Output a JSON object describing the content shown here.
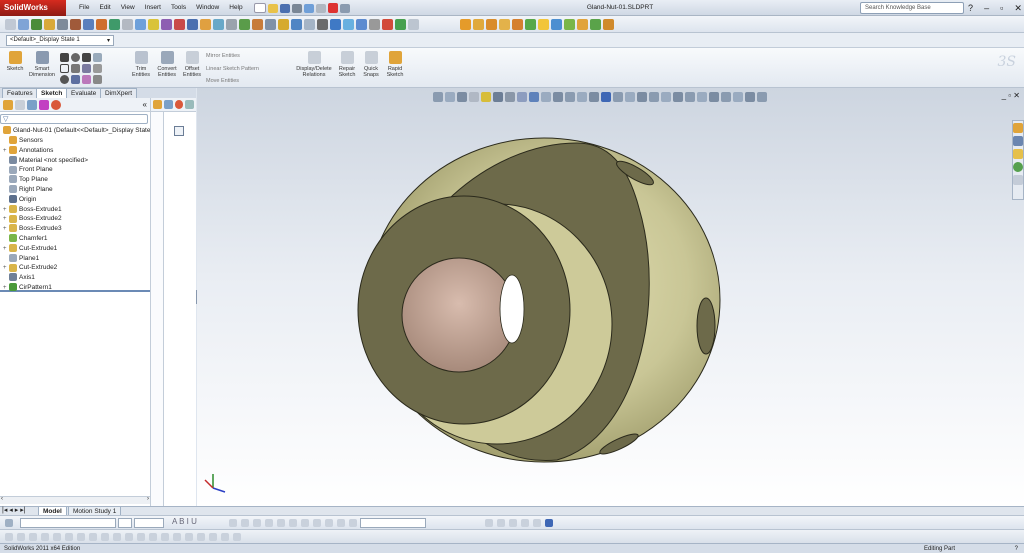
{
  "app": {
    "name": "SolidWorks",
    "menus": [
      "File",
      "Edit",
      "View",
      "Insert",
      "Tools",
      "Window",
      "Help"
    ],
    "document_title": "Gland-Nut-01.SLDPRT",
    "search_placeholder": "Search Knowledge Base",
    "window_controls": [
      "?",
      "–",
      "▫",
      "✕"
    ],
    "pin_icon": "›"
  },
  "config": {
    "selected": "<Default>_Display State 1"
  },
  "command_manager": {
    "buttons": [
      "Sketch",
      "Smart Dimension",
      "Trim Entities",
      "Convert Entities",
      "Offset Entities",
      "Display/Delete Relations",
      "Repair Sketch",
      "Quick Snaps",
      "Rapid Sketch"
    ],
    "small_tools": [
      "Mirror Entities",
      "Linear Sketch Pattern",
      "Move Entities"
    ]
  },
  "tabs": [
    "Features",
    "Sketch",
    "Evaluate",
    "DimXpert"
  ],
  "active_tab": "Sketch",
  "feature_tree": {
    "root": "Gland-Nut-01  (Default<<Default>_Display State",
    "items": [
      "Sensors",
      "Annotations",
      "Material <not specified>",
      "Front Plane",
      "Top Plane",
      "Right Plane",
      "Origin",
      "Boss-Extrude1",
      "Boss-Extrude2",
      "Boss-Extrude3",
      "Chamfer1",
      "Cut-Extrude1",
      "Plane1",
      "Cut-Extrude2",
      "Axis1",
      "CirPattern1"
    ],
    "expandable": [
      false,
      true,
      false,
      false,
      false,
      false,
      false,
      true,
      true,
      true,
      false,
      true,
      false,
      true,
      false,
      true
    ]
  },
  "bottom_tabs": [
    "Model",
    "Motion Study 1"
  ],
  "status": {
    "left": "SolidWorks 2011 x64 Edition",
    "right": "Editing Part"
  },
  "colors": {
    "accent": "#d62b1f",
    "part_face": "#6d6a4a",
    "part_face_light": "#c9c696",
    "part_bore": "#c7a99a"
  },
  "icons": {
    "tree": [
      "sensor-icon",
      "annotation-icon",
      "material-icon",
      "plane-icon",
      "plane-icon",
      "plane-icon",
      "origin-icon",
      "extrude-icon",
      "extrude-icon",
      "extrude-icon",
      "chamfer-icon",
      "cut-icon",
      "plane-icon",
      "cut-icon",
      "axis-icon",
      "pattern-icon"
    ]
  }
}
